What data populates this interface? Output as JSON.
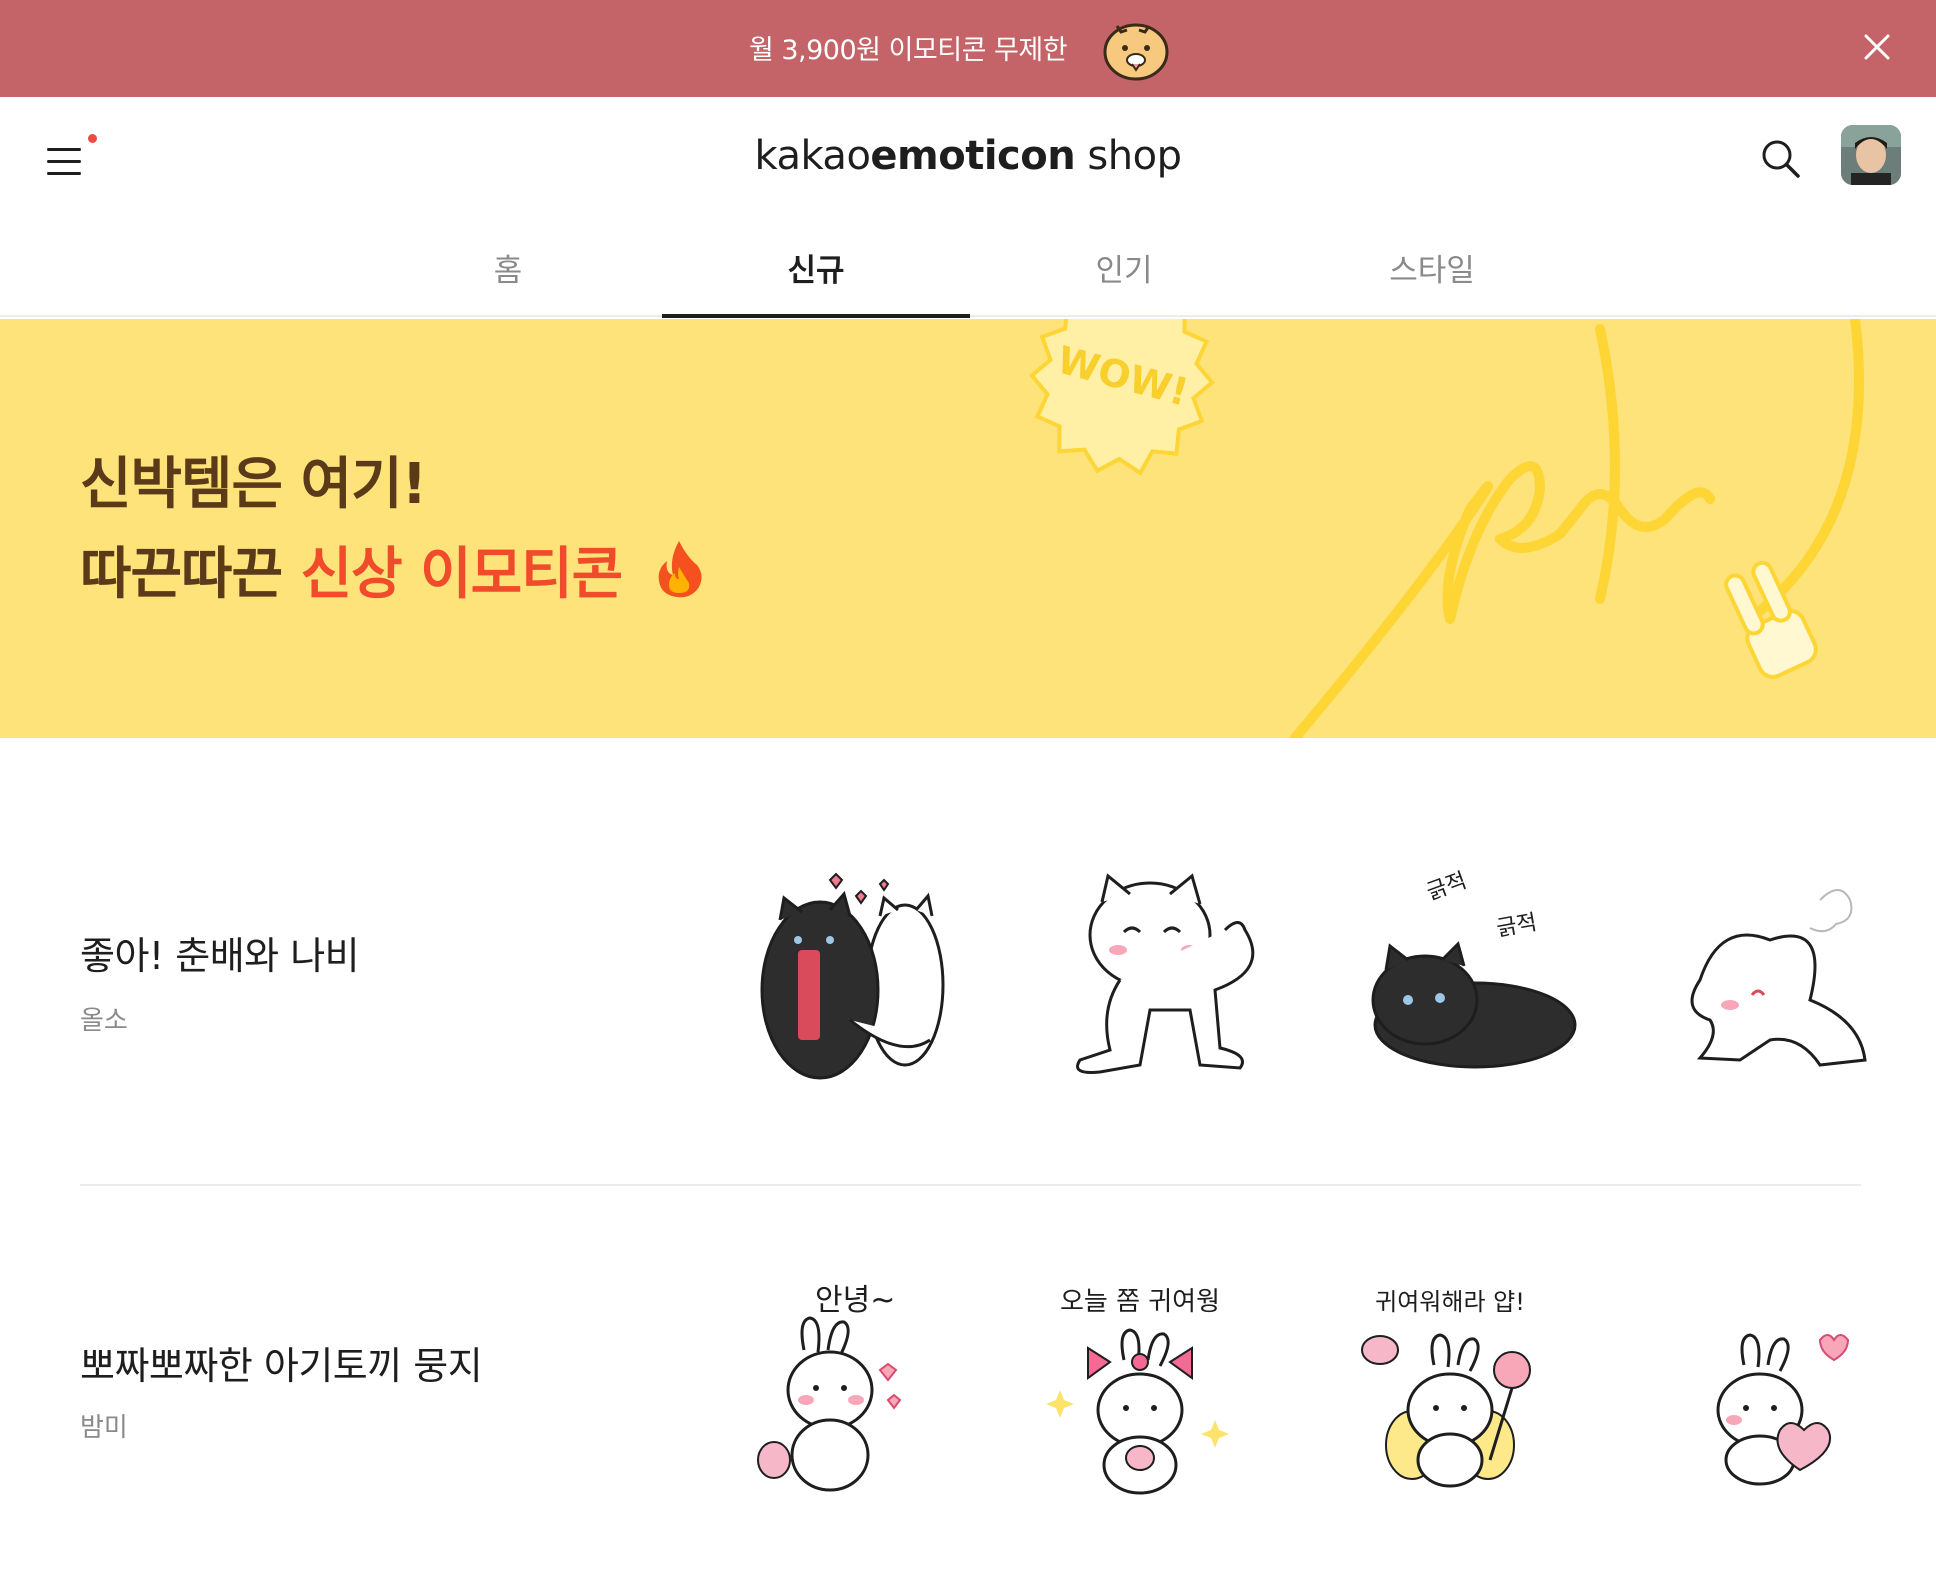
{
  "promo": {
    "text": "월 3,900원 이모티콘 무제한",
    "character_icon": "hamster-face-icon",
    "close_icon": "close-icon",
    "background": "#c46468"
  },
  "header": {
    "logo_prefix": "kakao",
    "logo_bold": "emoticon",
    "logo_suffix": " shop",
    "menu_icon": "hamburger-icon",
    "search_icon": "search-icon",
    "avatar": "user-avatar"
  },
  "tabs": [
    {
      "label": "홈",
      "active": false
    },
    {
      "label": "신규",
      "active": true
    },
    {
      "label": "인기",
      "active": false
    },
    {
      "label": "스타일",
      "active": false
    }
  ],
  "banner": {
    "line1": "신박템은 여기!",
    "line2_prefix": "따끈따끈 ",
    "line2_highlight": "신상 이모티콘",
    "fire_icon": "fire-icon",
    "badge_text": "WOW!",
    "script_text": "New",
    "hand_icon": "v-sign-hand-icon",
    "background": "#fee27a",
    "highlight_color": "#f04b2a"
  },
  "items": [
    {
      "title": "좋아! 춘배와 나비",
      "author": "올소",
      "thumbs": [
        {
          "name": "black-white-cats-hug-sticker"
        },
        {
          "name": "white-cat-giggle-sticker"
        },
        {
          "name": "black-cat-lying-sticker",
          "caption1": "긁적",
          "caption2": "긁적"
        },
        {
          "name": "white-cat-stretch-sticker"
        }
      ]
    },
    {
      "title": "뽀짜뽀짜한 아기토끼 뭉지",
      "author": "밤미",
      "thumbs": [
        {
          "name": "bunny-hello-sticker",
          "caption": "안녕~"
        },
        {
          "name": "bunny-bow-sticker",
          "caption": "오늘 쫌 귀여웡"
        },
        {
          "name": "bunny-fairy-sticker",
          "caption": "귀여워해라 얍!"
        },
        {
          "name": "bunny-heart-sticker"
        }
      ]
    }
  ]
}
